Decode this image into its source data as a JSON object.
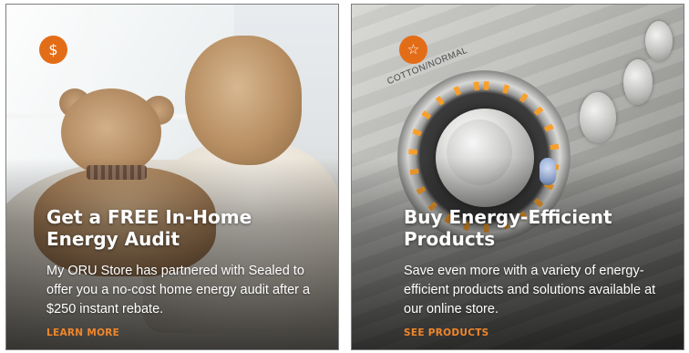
{
  "cards": [
    {
      "icon": "dollar-icon",
      "icon_glyph": "$",
      "title": "Get a FREE In-Home Energy Audit",
      "description": "My ORU Store has partnered with Sealed to offer you a no-cost home energy audit after a $250 instant rebate.",
      "cta": "LEARN MORE"
    },
    {
      "icon": "star-icon",
      "icon_glyph": "☆",
      "dial_label": "COTTON/NORMAL",
      "title": "Buy Energy-Efficient Products",
      "description": "Save even more with a variety of energy-efficient products and solutions available at our online store.",
      "cta": "SEE PRODUCTS"
    }
  ],
  "colors": {
    "accent_orange": "#e36d17",
    "cta_orange": "#f0862a",
    "text_white": "#ffffff"
  }
}
